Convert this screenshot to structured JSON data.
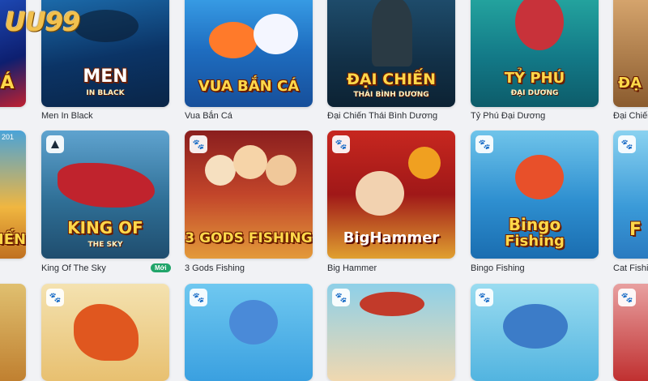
{
  "logo": {
    "text": "UU99"
  },
  "row1": [
    {
      "label": "",
      "art_title": "CÁ"
    },
    {
      "label": "Men In Black",
      "art_title": "MEN",
      "art_sub": "IN BLACK"
    },
    {
      "label": "Vua Bắn Cá",
      "art_title": "VUA BẮN CÁ"
    },
    {
      "label": "Đại Chiến Thái Bình Dương",
      "art_title": "ĐẠI CHIẾN",
      "art_sub": "THÁI BÌNH DƯƠNG"
    },
    {
      "label": "Tỷ Phú Đại Dương",
      "art_title": "TỶ PHÚ",
      "art_sub": "ĐẠI DƯƠNG"
    },
    {
      "label": "Đại Chiến",
      "art_title": "ĐẠ"
    }
  ],
  "row2": [
    {
      "label": "",
      "art_title": "IẾN",
      "corner_text": "201"
    },
    {
      "label": "King Of The Sky",
      "art_title": "KING OF",
      "art_sub": "THE SKY",
      "badge": "Mới"
    },
    {
      "label": "3 Gods Fishing",
      "art_title": "3 GODS FISHING"
    },
    {
      "label": "Big Hammer",
      "art_title": "BigHammer"
    },
    {
      "label": "Bingo Fishing",
      "art_title": "Bingo",
      "art_sub": "Fishing"
    },
    {
      "label": "Cat Fishi",
      "art_title": "F"
    }
  ],
  "row3": [
    {
      "label": ""
    },
    {
      "label": ""
    },
    {
      "label": ""
    },
    {
      "label": ""
    },
    {
      "label": ""
    },
    {
      "label": ""
    }
  ]
}
